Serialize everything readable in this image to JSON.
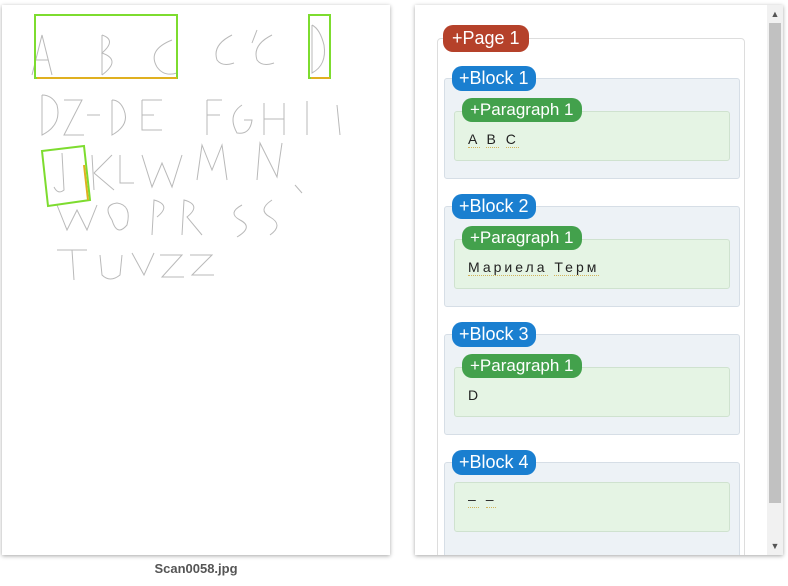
{
  "filename": "Scan0058.jpg",
  "page_label": "+Page 1",
  "blocks": [
    {
      "label": "+Block 1",
      "paragraph_label": "+Paragraph 1",
      "words": [
        "A",
        "B",
        "C"
      ]
    },
    {
      "label": "+Block 2",
      "paragraph_label": "+Paragraph 1",
      "words": [
        "Мариела",
        "Терм"
      ]
    },
    {
      "label": "+Block 3",
      "paragraph_label": "+Paragraph 1",
      "words": [
        "D"
      ]
    },
    {
      "label": "+Block 4",
      "paragraph_label": "",
      "words": [
        "–",
        "–"
      ]
    }
  ],
  "colors": {
    "page": "#b5412a",
    "block": "#1a7fd0",
    "paragraph": "#43a14c",
    "highlight": "#7ddc2f"
  },
  "icons": {
    "scroll_up": "triangle-up-icon",
    "scroll_down": "triangle-down-icon"
  }
}
